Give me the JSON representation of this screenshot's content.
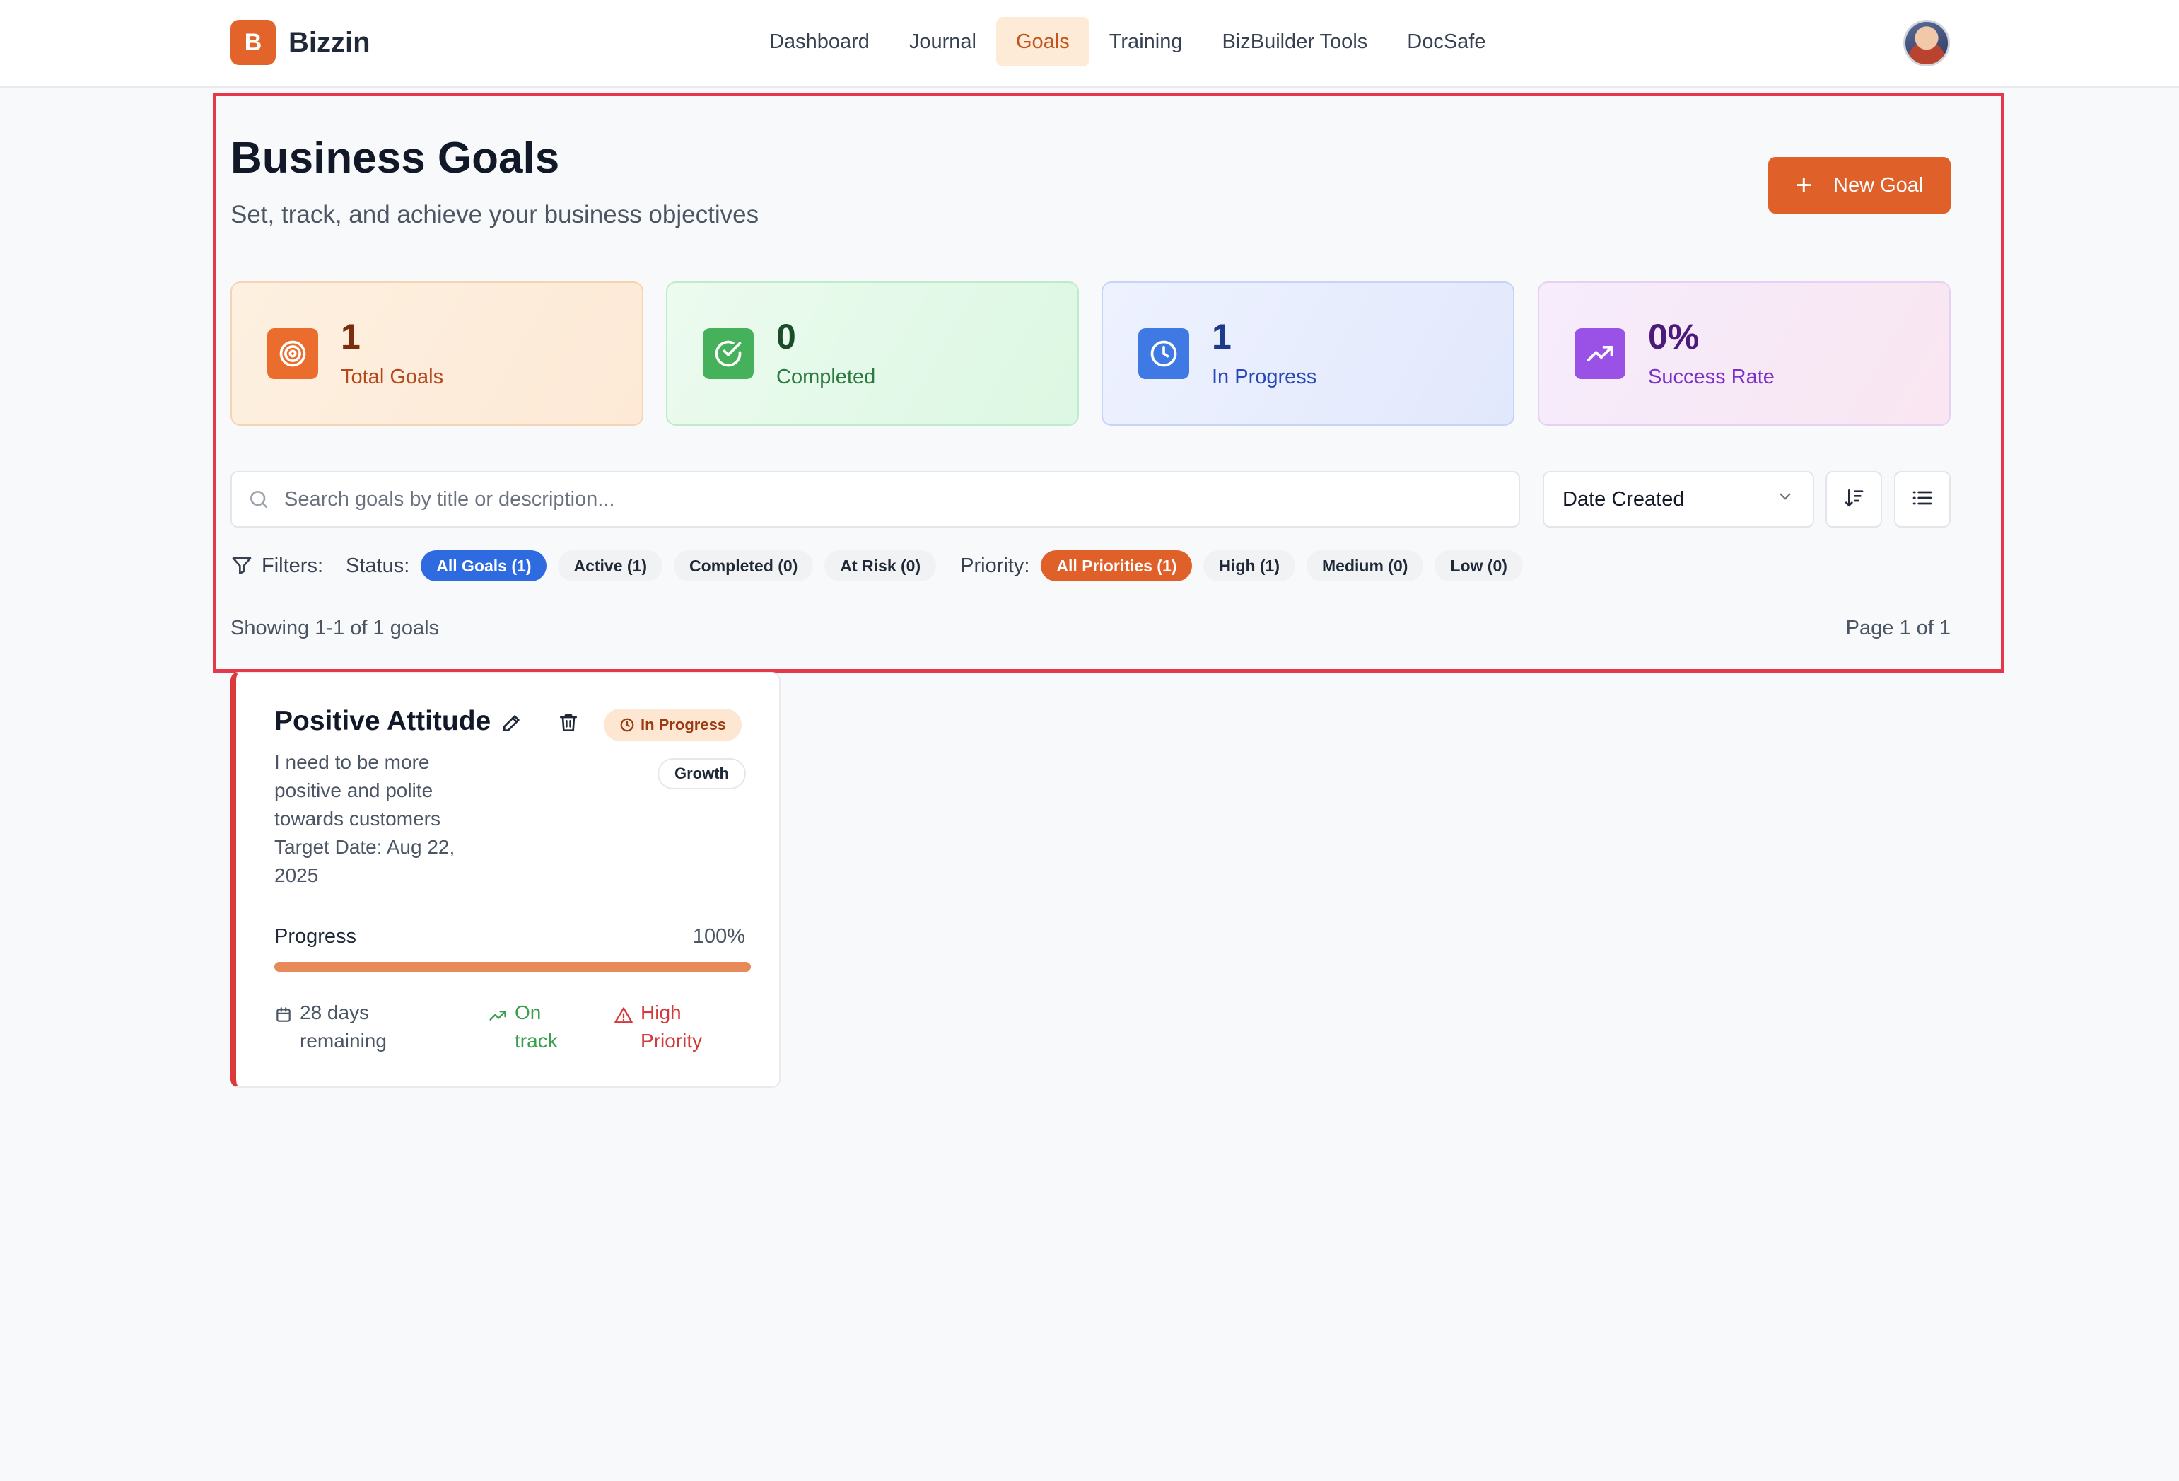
{
  "app": {
    "logo_letter": "B",
    "name": "Bizzin"
  },
  "nav": {
    "items": [
      {
        "label": "Dashboard",
        "active": false
      },
      {
        "label": "Journal",
        "active": false
      },
      {
        "label": "Goals",
        "active": true
      },
      {
        "label": "Training",
        "active": false
      },
      {
        "label": "BizBuilder Tools",
        "active": false
      },
      {
        "label": "DocSafe",
        "active": false
      }
    ]
  },
  "header": {
    "title": "Business Goals",
    "subtitle": "Set, track, and achieve your business objectives",
    "new_goal_label": "New Goal"
  },
  "stats": [
    {
      "value": "1",
      "label": "Total Goals",
      "icon": "target-icon",
      "color": "#ea6d2e"
    },
    {
      "value": "0",
      "label": "Completed",
      "icon": "check-circle-icon",
      "color": "#45b25b"
    },
    {
      "value": "1",
      "label": "In Progress",
      "icon": "clock-icon",
      "color": "#3f7ae4"
    },
    {
      "value": "0%",
      "label": "Success Rate",
      "icon": "trending-up-icon",
      "color": "#9a52e6"
    }
  ],
  "search": {
    "placeholder": "Search goals by title or description...",
    "value": ""
  },
  "sort": {
    "selected": "Date Created"
  },
  "filters": {
    "label": "Filters:",
    "status_label": "Status:",
    "status": [
      "All Goals (1)",
      "Active (1)",
      "Completed (0)",
      "At Risk (0)"
    ],
    "status_selected": "All Goals (1)",
    "priority_label": "Priority:",
    "priority": [
      "All Priorities (1)",
      "High (1)",
      "Medium (0)",
      "Low (0)"
    ],
    "priority_selected": "All Priorities (1)"
  },
  "results": {
    "showing": "Showing 1-1 of 1 goals",
    "page": "Page 1 of 1"
  },
  "goal": {
    "title": "Positive Attitude",
    "status": "In Progress",
    "category": "Growth",
    "description": "I need to be more positive and polite towards customers",
    "target_date": "Target Date: Aug 22, 2025",
    "progress_label": "Progress",
    "progress_text": "100%",
    "progress_fraction": 1.0,
    "days_remaining": "28 days remaining",
    "track_status": "On track",
    "priority": "High Priority"
  }
}
